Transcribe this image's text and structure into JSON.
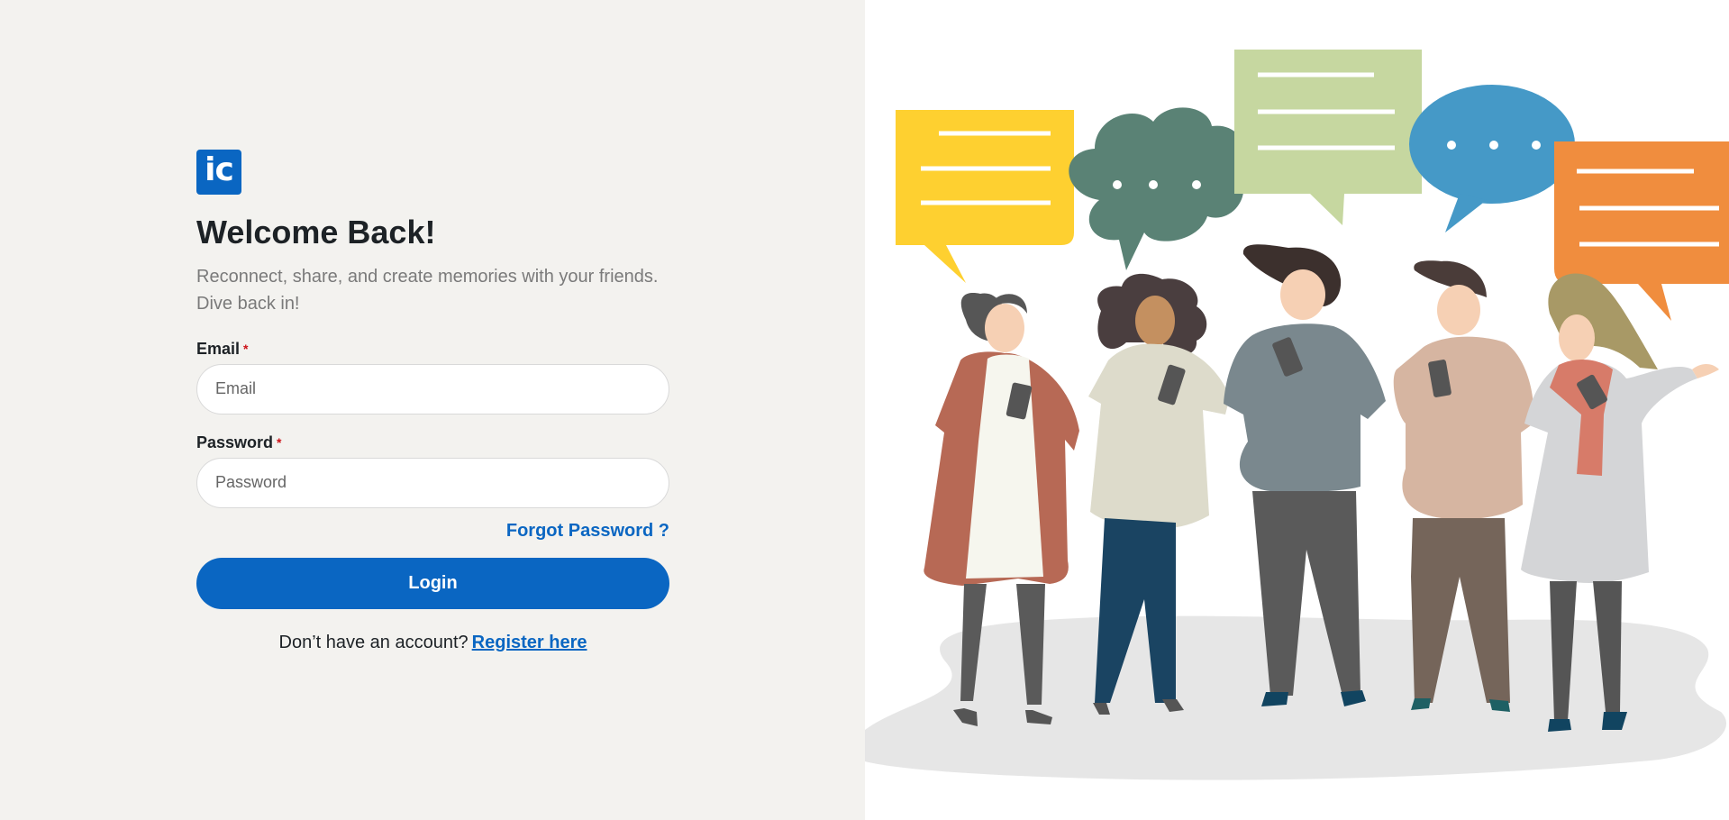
{
  "brand": {
    "logo_text": "ic",
    "primary_color": "#0a66c2"
  },
  "header": {
    "title": "Welcome Back!",
    "subtitle": "Reconnect, share, and create memories with your friends. Dive back in!"
  },
  "form": {
    "email": {
      "label": "Email",
      "required_mark": "*",
      "placeholder": "Email",
      "value": ""
    },
    "password": {
      "label": "Password",
      "required_mark": "*",
      "placeholder": "Password",
      "value": ""
    },
    "forgot_password_label": "Forgot Password ?",
    "login_label": "Login"
  },
  "footer": {
    "no_account_text": "Don’t have an account?",
    "register_label": "Register here"
  },
  "illustration": {
    "subject": "group-of-people-chatting-illustration",
    "bubble_colors": [
      "#fed030",
      "#5a8275",
      "#c6d7a0",
      "#4599c7",
      "#f08d3e"
    ]
  }
}
